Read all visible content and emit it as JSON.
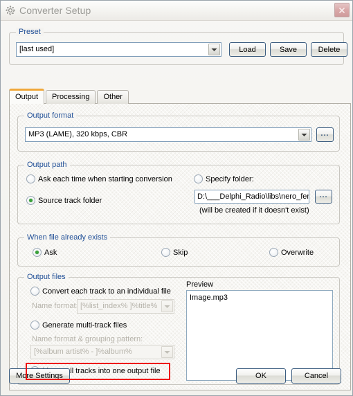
{
  "window": {
    "title": "Converter Setup",
    "icon": "gear-icon",
    "close_label": "×",
    "accent_orange": "#f0a73a",
    "link_blue": "#1f4e96",
    "highlight_red": "#ee1111",
    "radio_green": "#3aa23a"
  },
  "preset": {
    "group_title": "Preset",
    "value": "[last used]",
    "load_label": "Load",
    "save_label": "Save",
    "delete_label": "Delete"
  },
  "tabs": [
    {
      "label": "Output",
      "active": true
    },
    {
      "label": "Processing",
      "active": false
    },
    {
      "label": "Other",
      "active": false
    }
  ],
  "output_format": {
    "group_title": "Output format",
    "value": "MP3 (LAME), 320 kbps, CBR",
    "browse_label": "..."
  },
  "output_path": {
    "group_title": "Output path",
    "ask_each_time_label": "Ask each time when starting conversion",
    "ask_each_time_checked": false,
    "source_track_folder_label": "Source track folder",
    "source_track_folder_checked": true,
    "specify_folder_label": "Specify folder:",
    "specify_folder_checked": false,
    "folder_value": "D:\\___Delphi_Radio\\libs\\nero_fends",
    "browse_label": "...",
    "hint": "(will be created if it doesn't exist)"
  },
  "file_exists": {
    "group_title": "When file already exists",
    "options": [
      {
        "label": "Ask",
        "checked": true
      },
      {
        "label": "Skip",
        "checked": false
      },
      {
        "label": "Overwrite",
        "checked": false
      }
    ]
  },
  "output_files": {
    "group_title": "Output files",
    "convert_each_label": "Convert each track to an individual file",
    "convert_each_checked": false,
    "name_format_label": "Name format:",
    "name_format_value": "[%list_index% ]%title%",
    "generate_multi_label": "Generate multi-track files",
    "generate_multi_checked": false,
    "grouping_label": "Name format & grouping pattern:",
    "grouping_value": "[%album artist% - ]%album%",
    "merge_all_label": "Merge all tracks into one output file",
    "merge_all_checked": true,
    "merge_all_highlighted": true
  },
  "preview": {
    "label": "Preview",
    "lines": [
      "Image.mp3"
    ]
  },
  "footer": {
    "more_settings_label": "More Settings",
    "ok_label": "OK",
    "cancel_label": "Cancel"
  }
}
